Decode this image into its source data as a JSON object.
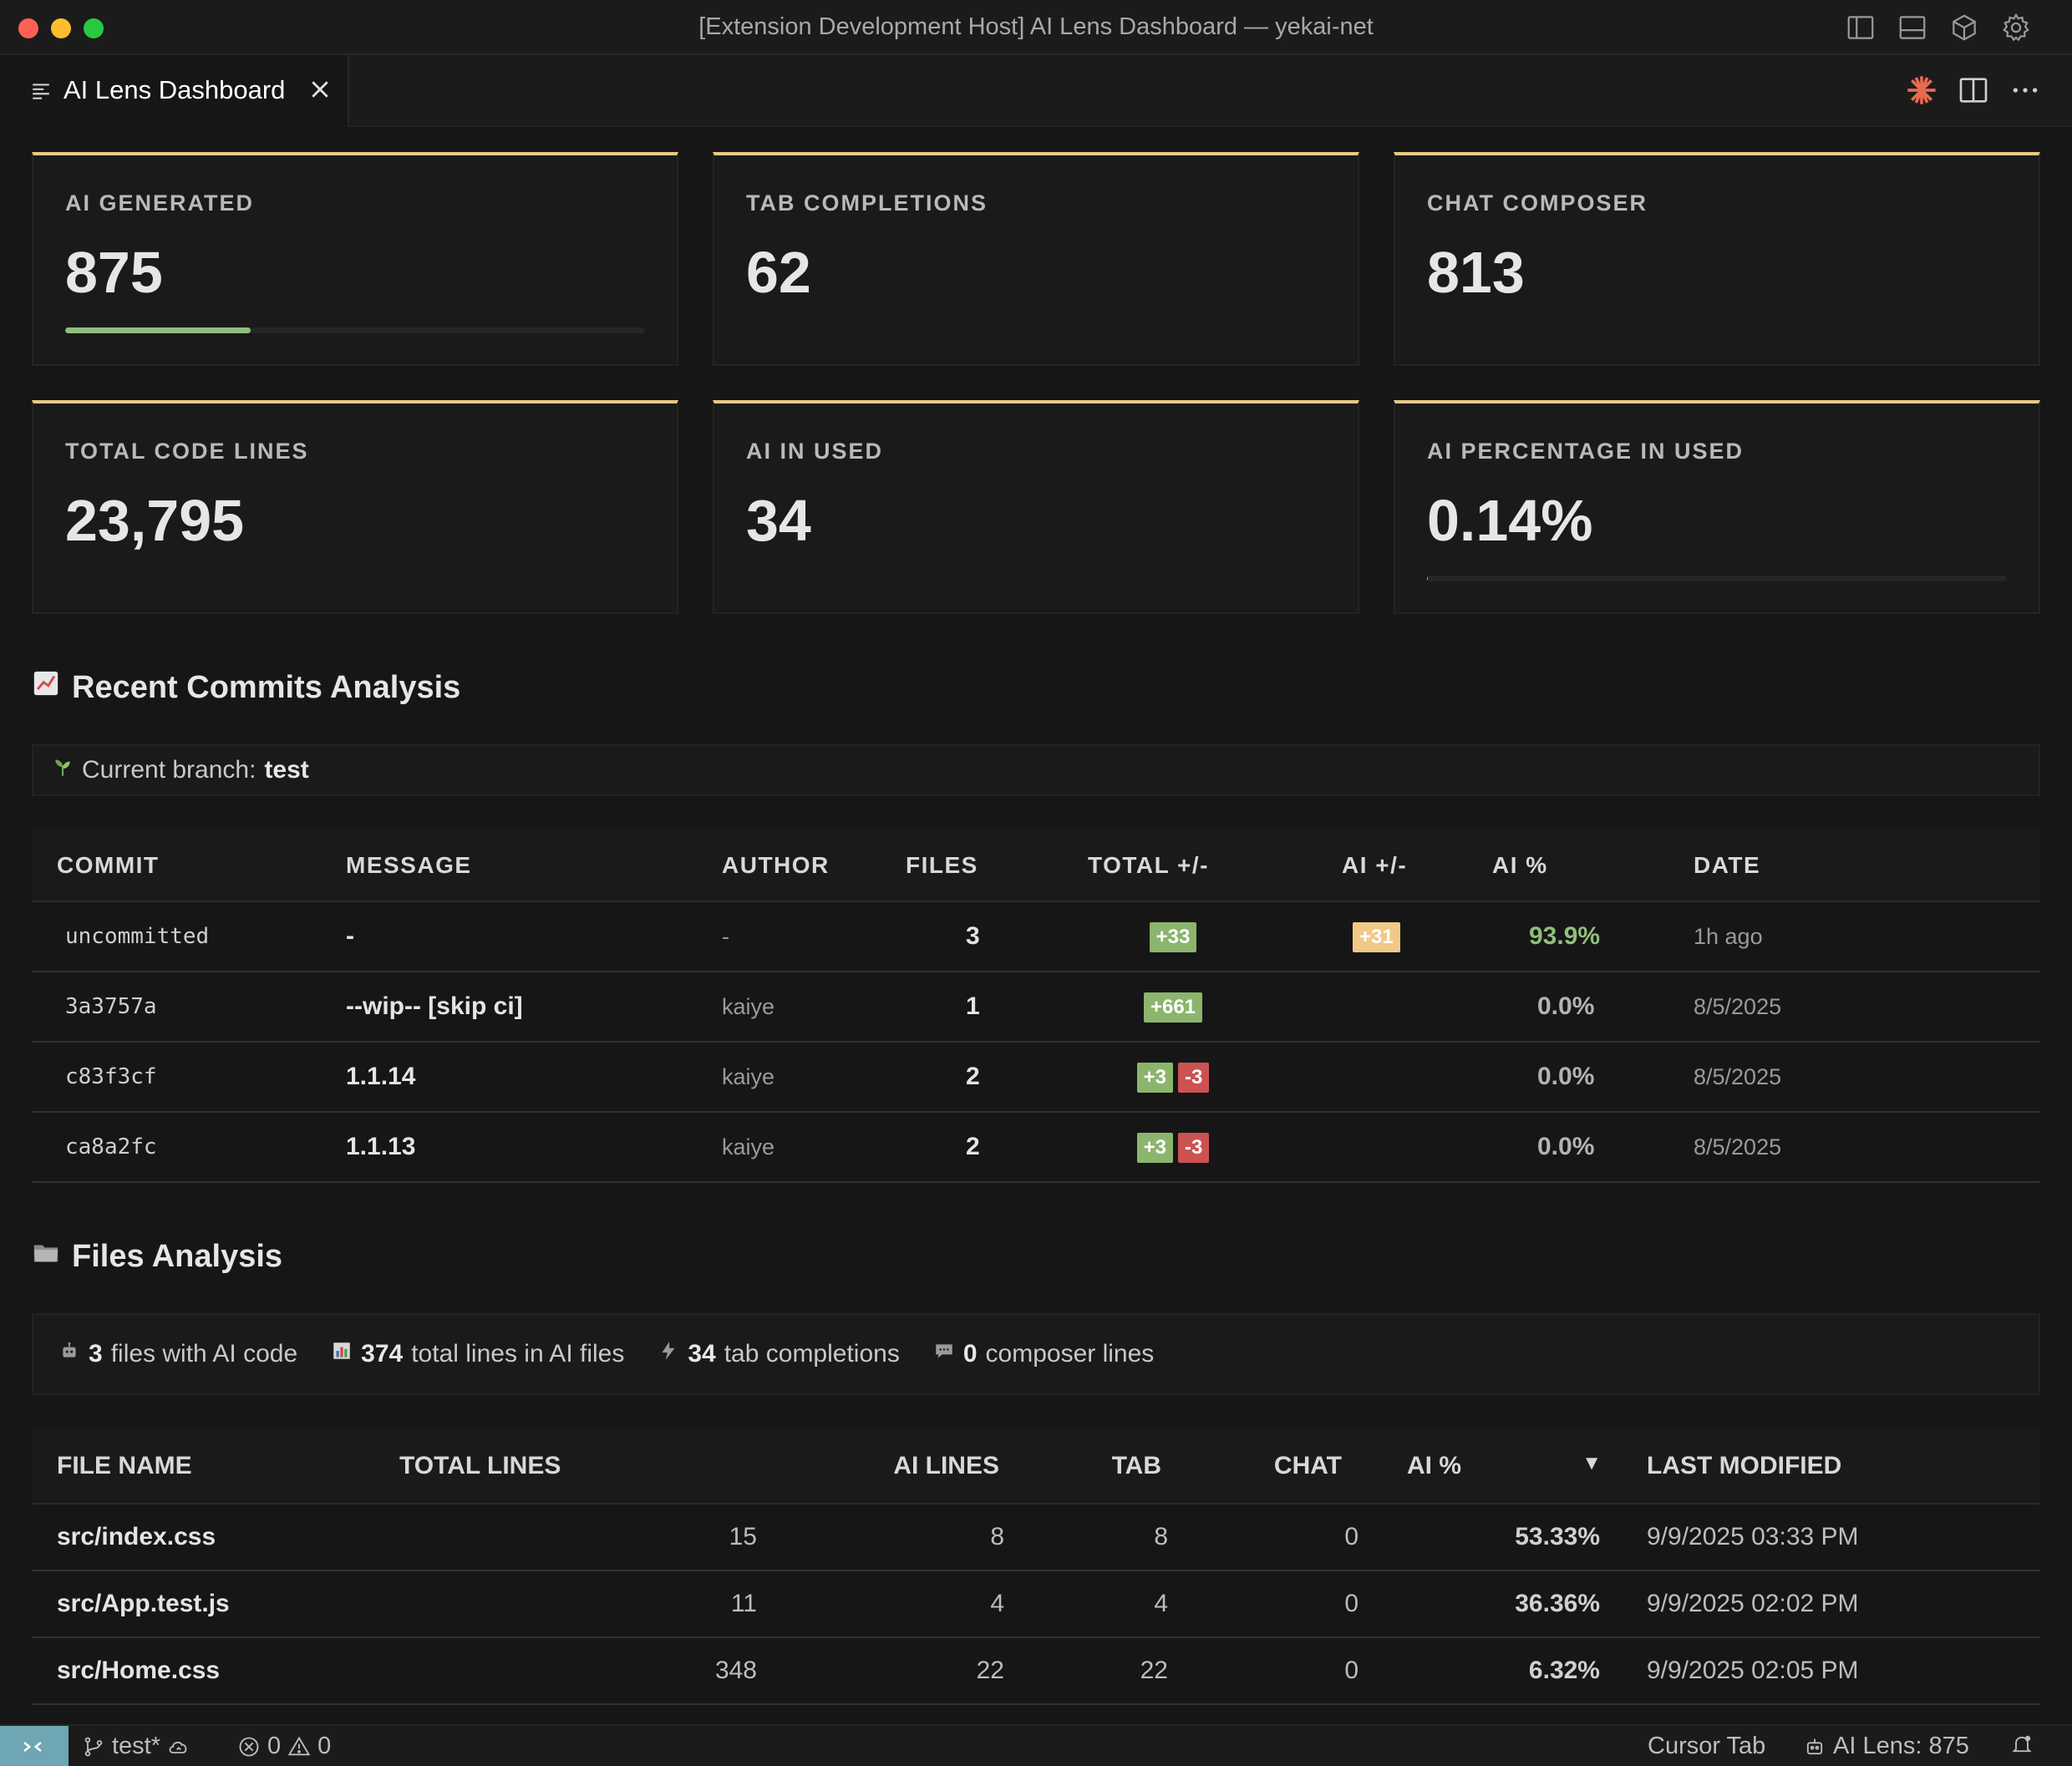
{
  "window": {
    "title": "[Extension Development Host] AI Lens Dashboard — yekai-net"
  },
  "tab": {
    "label": "AI Lens Dashboard"
  },
  "metrics": [
    {
      "label": "AI GENERATED",
      "value": "875",
      "progress": 0.32
    },
    {
      "label": "TAB COMPLETIONS",
      "value": "62"
    },
    {
      "label": "CHAT COMPOSER",
      "value": "813"
    },
    {
      "label": "TOTAL CODE LINES",
      "value": "23,795"
    },
    {
      "label": "AI IN USED",
      "value": "34"
    },
    {
      "label": "AI PERCENTAGE IN USED",
      "value": "0.14%",
      "progress": 0.0014
    }
  ],
  "commits_section": {
    "title": "Recent Commits Analysis",
    "branch_label": "Current branch:",
    "branch_name": "test",
    "headers": [
      "COMMIT",
      "MESSAGE",
      "AUTHOR",
      "FILES",
      "TOTAL +/-",
      "AI +/-",
      "AI %",
      "DATE"
    ],
    "rows": [
      {
        "commit": "uncommitted",
        "message": "-",
        "author": "-",
        "files": "3",
        "total_add": "+33",
        "total_del": "",
        "ai_add": "+31",
        "ai_pct": "93.9%",
        "date": "1h ago"
      },
      {
        "commit": "3a3757a",
        "message": "--wip-- [skip ci]",
        "author": "kaiye",
        "files": "1",
        "total_add": "+661",
        "total_del": "",
        "ai_add": "",
        "ai_pct": "0.0%",
        "date": "8/5/2025"
      },
      {
        "commit": "c83f3cf",
        "message": "1.1.14",
        "author": "kaiye",
        "files": "2",
        "total_add": "+3",
        "total_del": "-3",
        "ai_add": "",
        "ai_pct": "0.0%",
        "date": "8/5/2025"
      },
      {
        "commit": "ca8a2fc",
        "message": "1.1.13",
        "author": "kaiye",
        "files": "2",
        "total_add": "+3",
        "total_del": "-3",
        "ai_add": "",
        "ai_pct": "0.0%",
        "date": "8/5/2025"
      }
    ]
  },
  "files_section": {
    "title": "Files Analysis",
    "stats": [
      {
        "icon": "robot-icon",
        "value": "3",
        "text": "files with AI code"
      },
      {
        "icon": "bar-chart-icon",
        "value": "374",
        "text": "total lines in AI files"
      },
      {
        "icon": "lightning-icon",
        "value": "34",
        "text": "tab completions"
      },
      {
        "icon": "speech-bubble-icon",
        "value": "0",
        "text": "composer lines"
      }
    ],
    "headers": [
      "FILE NAME",
      "TOTAL LINES",
      "AI LINES",
      "TAB",
      "CHAT",
      "AI %",
      "LAST MODIFIED"
    ],
    "sort_indicator": "▼",
    "rows": [
      {
        "name": "src/index.css",
        "total": "15",
        "ai": "8",
        "tab": "8",
        "chat": "0",
        "pct": "53.33%",
        "modified": "9/9/2025 03:33 PM"
      },
      {
        "name": "src/App.test.js",
        "total": "11",
        "ai": "4",
        "tab": "4",
        "chat": "0",
        "pct": "36.36%",
        "modified": "9/9/2025 02:02 PM"
      },
      {
        "name": "src/Home.css",
        "total": "348",
        "ai": "22",
        "tab": "22",
        "chat": "0",
        "pct": "6.32%",
        "modified": "9/9/2025 02:05 PM"
      }
    ]
  },
  "statusbar": {
    "branch": "test*",
    "errors": "0",
    "warnings": "0",
    "cursor_tab": "Cursor Tab",
    "ai_lens": "AI Lens: 875"
  },
  "colors": {
    "accent_gold": "#e8c987",
    "add_green": "#8bb56c",
    "del_red": "#cc5252",
    "ai_badge": "#f0c987",
    "remote": "#6fa6b3"
  }
}
